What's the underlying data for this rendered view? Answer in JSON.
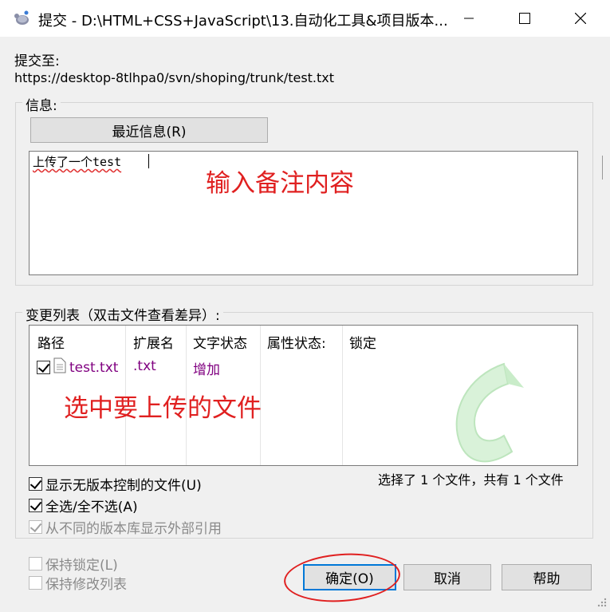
{
  "window": {
    "title": "提交 - D:\\HTML+CSS+JavaScript\\13.自动化工具&项目版本..."
  },
  "commit_to": {
    "label": "提交至:",
    "url": "https://desktop-8tlhpa0/svn/shoping/trunk/test.txt"
  },
  "message": {
    "group_label": "信息:",
    "recent_button": "最近信息(R)",
    "text": "上传了一个test"
  },
  "changes": {
    "group_label": "变更列表（双击文件查看差异）:",
    "columns": [
      "路径",
      "扩展名",
      "文字状态",
      "属性状态:",
      "锁定"
    ],
    "rows": [
      {
        "checked": true,
        "path": "test.txt",
        "ext": ".txt",
        "text_status": "增加",
        "prop_status": "",
        "lock": ""
      }
    ],
    "summary": "选择了 1 个文件，共有 1 个文件"
  },
  "options": {
    "show_unversioned": "显示无版本控制的文件(U)",
    "select_all": "全选/全不选(A)",
    "show_externals": "从不同的版本库显示外部引用",
    "keep_locks": "保持锁定(L)",
    "keep_changelists": "保持修改列表"
  },
  "buttons": {
    "ok": "确定(O)",
    "cancel": "取消",
    "help": "帮助"
  },
  "annotations": {
    "message_hint": "输入备注内容",
    "files_hint": "选中要上传的文件"
  },
  "colors": {
    "annotation": "#e02020",
    "added_status": "#800080",
    "focus_border": "#0078d7"
  }
}
